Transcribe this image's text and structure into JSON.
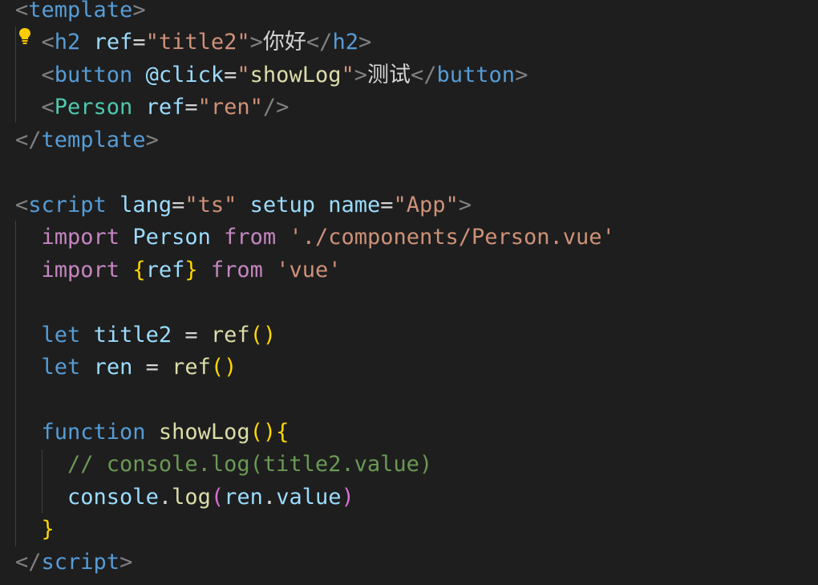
{
  "colors": {
    "background": "#1e1e1e",
    "punctuation": "#808080",
    "tag": "#569cd6",
    "component": "#4ec9b0",
    "attribute": "#9cdcfe",
    "string": "#ce9178",
    "text": "#d4d4d4",
    "keyword": "#c586c0",
    "storage": "#569cd6",
    "function": "#dcdcaa",
    "bracket1": "#ffd700",
    "bracket2": "#da70d6",
    "comment": "#6a9955",
    "lightbulb": "#ffcc00"
  },
  "icons": {
    "lightbulb": "lightbulb-icon"
  },
  "lines": [
    {
      "name": "code-line-1",
      "tokens": [
        {
          "t": "<",
          "c": "punctuation"
        },
        {
          "t": "template",
          "c": "tag"
        },
        {
          "t": ">",
          "c": "punctuation"
        }
      ]
    },
    {
      "name": "code-line-2",
      "tokens": [
        {
          "t": "  ",
          "c": "text"
        },
        {
          "t": "<",
          "c": "punctuation"
        },
        {
          "t": "h2",
          "c": "tag"
        },
        {
          "t": " ",
          "c": "text"
        },
        {
          "t": "ref",
          "c": "attribute"
        },
        {
          "t": "=",
          "c": "text"
        },
        {
          "t": "\"title2\"",
          "c": "string"
        },
        {
          "t": ">",
          "c": "punctuation"
        },
        {
          "t": "你好",
          "c": "text"
        },
        {
          "t": "</",
          "c": "punctuation"
        },
        {
          "t": "h2",
          "c": "tag"
        },
        {
          "t": ">",
          "c": "punctuation"
        }
      ]
    },
    {
      "name": "code-line-3",
      "tokens": [
        {
          "t": "  ",
          "c": "text"
        },
        {
          "t": "<",
          "c": "punctuation"
        },
        {
          "t": "button",
          "c": "tag"
        },
        {
          "t": " ",
          "c": "text"
        },
        {
          "t": "@click",
          "c": "attribute"
        },
        {
          "t": "=",
          "c": "text"
        },
        {
          "t": "\"",
          "c": "string"
        },
        {
          "t": "showLog",
          "c": "function"
        },
        {
          "t": "\"",
          "c": "string"
        },
        {
          "t": ">",
          "c": "punctuation"
        },
        {
          "t": "测试",
          "c": "text"
        },
        {
          "t": "</",
          "c": "punctuation"
        },
        {
          "t": "button",
          "c": "tag"
        },
        {
          "t": ">",
          "c": "punctuation"
        }
      ]
    },
    {
      "name": "code-line-4",
      "tokens": [
        {
          "t": "  ",
          "c": "text"
        },
        {
          "t": "<",
          "c": "punctuation"
        },
        {
          "t": "Person",
          "c": "component"
        },
        {
          "t": " ",
          "c": "text"
        },
        {
          "t": "ref",
          "c": "attribute"
        },
        {
          "t": "=",
          "c": "text"
        },
        {
          "t": "\"ren\"",
          "c": "string"
        },
        {
          "t": "/>",
          "c": "punctuation"
        }
      ]
    },
    {
      "name": "code-line-5",
      "tokens": [
        {
          "t": "</",
          "c": "punctuation"
        },
        {
          "t": "template",
          "c": "tag"
        },
        {
          "t": ">",
          "c": "punctuation"
        }
      ]
    },
    {
      "name": "code-line-6",
      "tokens": []
    },
    {
      "name": "code-line-7",
      "tokens": [
        {
          "t": "<",
          "c": "punctuation"
        },
        {
          "t": "script",
          "c": "tag"
        },
        {
          "t": " ",
          "c": "text"
        },
        {
          "t": "lang",
          "c": "attribute"
        },
        {
          "t": "=",
          "c": "text"
        },
        {
          "t": "\"ts\"",
          "c": "string"
        },
        {
          "t": " ",
          "c": "text"
        },
        {
          "t": "setup",
          "c": "attribute"
        },
        {
          "t": " ",
          "c": "text"
        },
        {
          "t": "name",
          "c": "attribute"
        },
        {
          "t": "=",
          "c": "text"
        },
        {
          "t": "\"App\"",
          "c": "string"
        },
        {
          "t": ">",
          "c": "punctuation"
        }
      ]
    },
    {
      "name": "code-line-8",
      "tokens": [
        {
          "t": "  ",
          "c": "text"
        },
        {
          "t": "import",
          "c": "keyword"
        },
        {
          "t": " ",
          "c": "text"
        },
        {
          "t": "Person",
          "c": "attribute"
        },
        {
          "t": " ",
          "c": "text"
        },
        {
          "t": "from",
          "c": "keyword"
        },
        {
          "t": " ",
          "c": "text"
        },
        {
          "t": "'./components/Person.vue'",
          "c": "string"
        }
      ]
    },
    {
      "name": "code-line-9",
      "tokens": [
        {
          "t": "  ",
          "c": "text"
        },
        {
          "t": "import",
          "c": "keyword"
        },
        {
          "t": " ",
          "c": "text"
        },
        {
          "t": "{",
          "c": "bracket1"
        },
        {
          "t": "ref",
          "c": "attribute"
        },
        {
          "t": "}",
          "c": "bracket1"
        },
        {
          "t": " ",
          "c": "text"
        },
        {
          "t": "from",
          "c": "keyword"
        },
        {
          "t": " ",
          "c": "text"
        },
        {
          "t": "'vue'",
          "c": "string"
        }
      ]
    },
    {
      "name": "code-line-10",
      "tokens": []
    },
    {
      "name": "code-line-11",
      "tokens": [
        {
          "t": "  ",
          "c": "text"
        },
        {
          "t": "let",
          "c": "storage"
        },
        {
          "t": " ",
          "c": "text"
        },
        {
          "t": "title2",
          "c": "attribute"
        },
        {
          "t": " = ",
          "c": "text"
        },
        {
          "t": "ref",
          "c": "function"
        },
        {
          "t": "()",
          "c": "bracket1"
        }
      ]
    },
    {
      "name": "code-line-12",
      "tokens": [
        {
          "t": "  ",
          "c": "text"
        },
        {
          "t": "let",
          "c": "storage"
        },
        {
          "t": " ",
          "c": "text"
        },
        {
          "t": "ren",
          "c": "attribute"
        },
        {
          "t": " = ",
          "c": "text"
        },
        {
          "t": "ref",
          "c": "function"
        },
        {
          "t": "()",
          "c": "bracket1"
        }
      ]
    },
    {
      "name": "code-line-13",
      "tokens": []
    },
    {
      "name": "code-line-14",
      "tokens": [
        {
          "t": "  ",
          "c": "text"
        },
        {
          "t": "function",
          "c": "storage"
        },
        {
          "t": " ",
          "c": "text"
        },
        {
          "t": "showLog",
          "c": "function"
        },
        {
          "t": "()",
          "c": "bracket1"
        },
        {
          "t": "{",
          "c": "bracket1"
        }
      ]
    },
    {
      "name": "code-line-15",
      "tokens": [
        {
          "t": "    ",
          "c": "text"
        },
        {
          "t": "// console.log(title2.value)",
          "c": "comment"
        }
      ]
    },
    {
      "name": "code-line-16",
      "tokens": [
        {
          "t": "    ",
          "c": "text"
        },
        {
          "t": "console",
          "c": "attribute"
        },
        {
          "t": ".",
          "c": "text"
        },
        {
          "t": "log",
          "c": "function"
        },
        {
          "t": "(",
          "c": "bracket2"
        },
        {
          "t": "ren",
          "c": "attribute"
        },
        {
          "t": ".",
          "c": "text"
        },
        {
          "t": "value",
          "c": "attribute"
        },
        {
          "t": ")",
          "c": "bracket2"
        }
      ]
    },
    {
      "name": "code-line-17",
      "tokens": [
        {
          "t": "  ",
          "c": "text"
        },
        {
          "t": "}",
          "c": "bracket1"
        }
      ]
    },
    {
      "name": "code-line-18",
      "tokens": [
        {
          "t": "</",
          "c": "punctuation"
        },
        {
          "t": "script",
          "c": "tag"
        },
        {
          "t": ">",
          "c": "punctuation"
        }
      ]
    }
  ]
}
